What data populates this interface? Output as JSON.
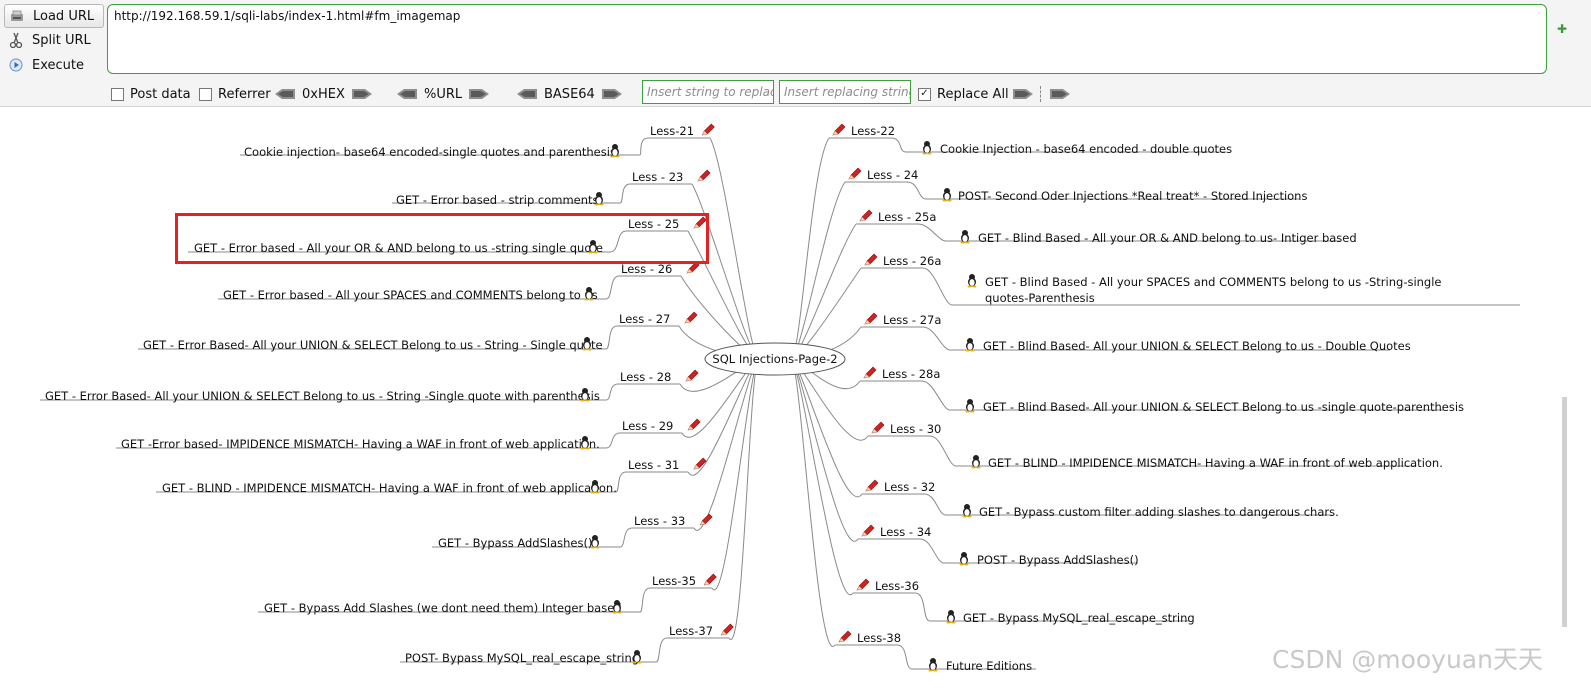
{
  "hackbar": {
    "load_url": "Load URL",
    "split_url": "Split URL",
    "execute": "Execute",
    "url_value": "http://192.168.59.1/sqli-labs/index-1.html#fm_imagemap",
    "post_data": "Post data",
    "referrer": "Referrer",
    "hex": "0xHEX",
    "url_enc": "%URL",
    "base64": "BASE64",
    "insert_placeholder": "Insert string to replace",
    "replacing_placeholder": "Insert replacing string",
    "replace_all": "Replace All",
    "replace_all_checked": true
  },
  "mindmap": {
    "center": "SQL Injections-Page-2",
    "left_nodes": [
      {
        "less": "Less-21",
        "desc": "Cookie injection- base64 encoded-single quotes and parenthesis"
      },
      {
        "less": "Less - 23",
        "desc": "GET - Error based - strip comments"
      },
      {
        "less": "Less - 25",
        "desc": "GET - Error based - All your OR & AND belong to us -string single quote"
      },
      {
        "less": "Less - 26",
        "desc": "GET - Error based - All your SPACES and COMMENTS belong to us"
      },
      {
        "less": "Less - 27",
        "desc": "GET - Error Based- All your UNION & SELECT Belong to us - String - Single quote"
      },
      {
        "less": "Less - 28",
        "desc": "GET - Error Based- All your UNION & SELECT Belong to us - String -Single quote with parenthesis"
      },
      {
        "less": "Less - 29",
        "desc": "GET -Error based- IMPIDENCE MISMATCH- Having a WAF in front of web application."
      },
      {
        "less": "Less - 31",
        "desc": "GET - BLIND - IMPIDENCE MISMATCH- Having a WAF in front of web application."
      },
      {
        "less": "Less - 33",
        "desc": "GET - Bypass AddSlashes()"
      },
      {
        "less": "Less-35",
        "desc": "GET - Bypass Add Slashes (we dont need them) Integer based"
      },
      {
        "less": "Less-37",
        "desc": "POST- Bypass MySQL_real_escape_string"
      }
    ],
    "right_nodes": [
      {
        "less": "Less-22",
        "desc": "Cookie Injection - base64 encoded - double quotes"
      },
      {
        "less": "Less - 24",
        "desc": "POST- Second Oder Injections *Real treat* - Stored Injections"
      },
      {
        "less": "Less - 25a",
        "desc": "GET - Blind Based - All your OR & AND belong to us- Intiger based"
      },
      {
        "less": "Less - 26a",
        "desc": "GET - Blind Based - All your SPACES and COMMENTS belong to us -String-single",
        "desc2": "quotes-Parenthesis"
      },
      {
        "less": "Less - 27a",
        "desc": "GET - Blind Based- All your UNION & SELECT Belong to us - Double Quotes"
      },
      {
        "less": "Less - 28a",
        "desc": "GET - Blind Based- All your UNION & SELECT Belong to us -single quote-parenthesis"
      },
      {
        "less": "Less - 30",
        "desc": "GET - BLIND - IMPIDENCE MISMATCH- Having a WAF in front of web application."
      },
      {
        "less": "Less - 32",
        "desc": "GET - Bypass custom filter adding slashes to dangerous chars."
      },
      {
        "less": "Less - 34",
        "desc": "POST - Bypass AddSlashes()"
      },
      {
        "less": "Less-36",
        "desc": "GET - Bypass MySQL_real_escape_string"
      },
      {
        "less": "Less-38",
        "desc": "Future Editions"
      }
    ]
  },
  "watermark": "CSDN @mooyuan天天",
  "colors": {
    "highlight": "#e52222",
    "input_border": "#3f9f3f"
  }
}
